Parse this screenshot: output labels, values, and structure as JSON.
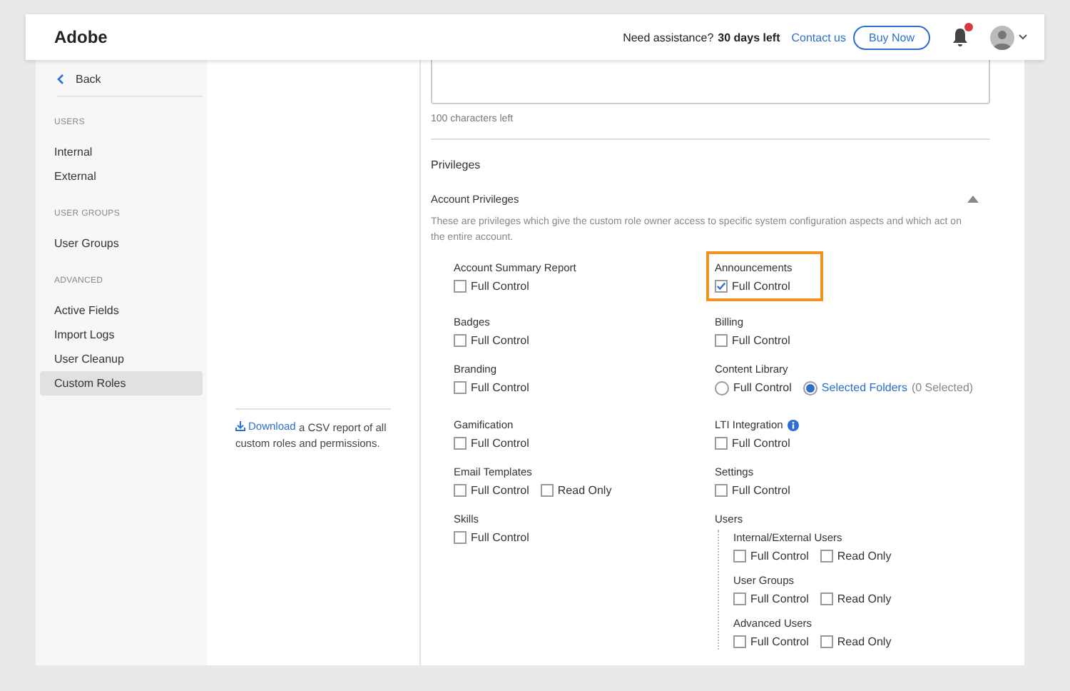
{
  "header": {
    "logo": "Adobe",
    "assistance": "Need assistance?",
    "trial": "30 days left",
    "contact": "Contact us",
    "buy": "Buy Now",
    "notifications": true
  },
  "sidebar": {
    "back": "Back",
    "sections": [
      {
        "heading": "USERS",
        "items": [
          {
            "label": "Internal",
            "selected": false
          },
          {
            "label": "External",
            "selected": false
          }
        ]
      },
      {
        "heading": "USER GROUPS",
        "items": [
          {
            "label": "User Groups",
            "selected": false
          }
        ]
      },
      {
        "heading": "ADVANCED",
        "items": [
          {
            "label": "Active Fields",
            "selected": false
          },
          {
            "label": "Import Logs",
            "selected": false
          },
          {
            "label": "User Cleanup",
            "selected": false
          },
          {
            "label": "Custom Roles",
            "selected": true
          }
        ]
      }
    ]
  },
  "download": {
    "link": "Download",
    "text": "a CSV report of all custom roles and permissions."
  },
  "form": {
    "chars_left": "100 characters left",
    "privileges_title": "Privileges",
    "section": {
      "title": "Account Privileges",
      "expanded": true,
      "description": "These are privileges which give the custom role owner access to specific system configuration aspects and which act on the entire account."
    }
  },
  "privileges": [
    {
      "name": "Account Summary Report",
      "highlighted": false,
      "options": [
        {
          "kind": "checkbox",
          "label": "Full Control",
          "checked": false
        }
      ]
    },
    {
      "name": "Announcements",
      "highlighted": true,
      "options": [
        {
          "kind": "checkbox",
          "label": "Full Control",
          "checked": true
        }
      ]
    },
    {
      "name": "Badges",
      "highlighted": false,
      "options": [
        {
          "kind": "checkbox",
          "label": "Full Control",
          "checked": false
        }
      ]
    },
    {
      "name": "Billing",
      "highlighted": false,
      "options": [
        {
          "kind": "checkbox",
          "label": "Full Control",
          "checked": false
        }
      ]
    },
    {
      "name": "Branding",
      "highlighted": false,
      "options": [
        {
          "kind": "checkbox",
          "label": "Full Control",
          "checked": false
        }
      ]
    },
    {
      "name": "Content Library",
      "highlighted": false,
      "options": [
        {
          "kind": "radio",
          "label": "Full Control",
          "selected": false
        },
        {
          "kind": "radio",
          "label": "Selected Folders",
          "note": "(0 Selected)",
          "selected": true
        }
      ]
    },
    {
      "name": "Gamification",
      "highlighted": false,
      "options": [
        {
          "kind": "checkbox",
          "label": "Full Control",
          "checked": false
        }
      ]
    },
    {
      "name": "LTI Integration",
      "highlighted": false,
      "info": true,
      "options": [
        {
          "kind": "checkbox",
          "label": "Full Control",
          "checked": false
        }
      ]
    },
    {
      "name": "Email Templates",
      "highlighted": false,
      "options": [
        {
          "kind": "checkbox",
          "label": "Full Control",
          "checked": false
        },
        {
          "kind": "checkbox",
          "label": "Read Only",
          "checked": false
        }
      ]
    },
    {
      "name": "Settings",
      "highlighted": false,
      "options": [
        {
          "kind": "checkbox",
          "label": "Full Control",
          "checked": false
        }
      ]
    },
    {
      "name": "Skills",
      "highlighted": false,
      "options": [
        {
          "kind": "checkbox",
          "label": "Full Control",
          "checked": false
        }
      ]
    },
    {
      "name": "Users",
      "highlighted": false,
      "children": [
        {
          "name": "Internal/External Users",
          "options": [
            {
              "kind": "checkbox",
              "label": "Full Control",
              "checked": false
            },
            {
              "kind": "checkbox",
              "label": "Read Only",
              "checked": false
            }
          ]
        },
        {
          "name": "User Groups",
          "options": [
            {
              "kind": "checkbox",
              "label": "Full Control",
              "checked": false
            },
            {
              "kind": "checkbox",
              "label": "Read Only",
              "checked": false
            }
          ]
        },
        {
          "name": "Advanced Users",
          "options": [
            {
              "kind": "checkbox",
              "label": "Full Control",
              "checked": false
            },
            {
              "kind": "checkbox",
              "label": "Read Only",
              "checked": false
            }
          ]
        }
      ]
    }
  ]
}
